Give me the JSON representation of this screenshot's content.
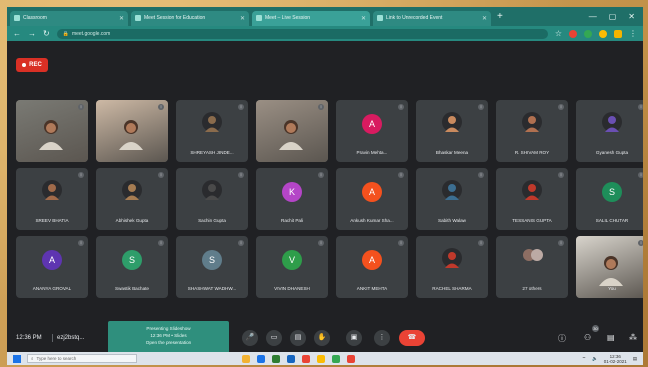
{
  "browser": {
    "tabs": [
      {
        "title": "Classroom",
        "active": false
      },
      {
        "title": "Meet Session for Education",
        "active": false
      },
      {
        "title": "Meet – Live Session",
        "active": true
      },
      {
        "title": "Link to Unrecorded Event",
        "active": false
      }
    ],
    "new_tab": "+",
    "url": "meet.google.com"
  },
  "meeting": {
    "rec_label": "REC",
    "time": "12:36 PM",
    "code": "ezj2bstq...",
    "popup_lines": [
      "Presenting Slideshow",
      "12:36 PM • Slides",
      "Open the presentation"
    ],
    "people_badge": "30"
  },
  "participants": [
    {
      "name": "",
      "type": "camera",
      "bg": "#7a7a74"
    },
    {
      "name": "",
      "type": "camera",
      "bg": "#cdb9a5"
    },
    {
      "name": "SHREYASH JINDE...",
      "type": "photo",
      "color": "#8a6b4c"
    },
    {
      "name": "",
      "type": "camera",
      "bg": "#9a8f84"
    },
    {
      "name": "Pravin Mehta...",
      "type": "avatar",
      "letter": "A",
      "color": "#d81b60"
    },
    {
      "name": "Bhaskar Meena",
      "type": "photo",
      "color": "#c98a5e"
    },
    {
      "name": "R. SHIVAM ROY",
      "type": "photo",
      "color": "#b07050"
    },
    {
      "name": "Gyanesh Gupta",
      "type": "photo",
      "color": "#6a4fb3"
    },
    {
      "name": "SREEV BHATIA",
      "type": "photo",
      "color": "#a06a4a"
    },
    {
      "name": "Abhishek Gupta",
      "type": "photo",
      "color": "#a67c52"
    },
    {
      "name": "Sachin Gupta",
      "type": "photo",
      "color": "#4a4a4a"
    },
    {
      "name": "Rachit Pali",
      "type": "avatar",
      "letter": "K",
      "color": "#b445c7"
    },
    {
      "name": "Ankush Kumar Sha...",
      "type": "avatar",
      "letter": "A",
      "color": "#f4511e"
    },
    {
      "name": "Sabith Walaw",
      "type": "photo",
      "color": "#3c6e91"
    },
    {
      "name": "TESSANIS GUPTA",
      "type": "photo",
      "color": "#c0392b"
    },
    {
      "name": "SALIL CHUTAR",
      "type": "avatar",
      "letter": "S",
      "color": "#1e8e5a"
    },
    {
      "name": "ANANYA GROVAL",
      "type": "avatar",
      "letter": "A",
      "color": "#5e35b1"
    },
    {
      "name": "Swastik Bachate",
      "type": "avatar",
      "letter": "S",
      "color": "#2e9d6a"
    },
    {
      "name": "SHASHWAT WADHW...",
      "type": "avatar",
      "letter": "S",
      "color": "#607d8b"
    },
    {
      "name": "VIVIN DHANESH",
      "type": "avatar",
      "letter": "V",
      "color": "#2e9d4a"
    },
    {
      "name": "ANKIT MEHTA",
      "type": "avatar",
      "letter": "A",
      "color": "#f4511e"
    },
    {
      "name": "RACHEL SHARMA",
      "type": "photo",
      "color": "#c0392b"
    },
    {
      "name": "27 others",
      "type": "group",
      "color": "#9aa0a6"
    },
    {
      "name": "You",
      "type": "camera",
      "bg": "#d8d4cc"
    }
  ],
  "controls": {
    "mic": "🎤",
    "cam": "▭",
    "cc": "▤",
    "hand": "✋",
    "present": "▣",
    "more": "⋮",
    "end": "☎",
    "info": "ⓘ",
    "people": "⚇",
    "chat": "▤",
    "activities": "⁂"
  },
  "taskbar": {
    "search_placeholder": "Type here to search",
    "time": "12:36",
    "date": "01-02-2021",
    "app_colors": [
      "#f2b233",
      "#1a73e8",
      "#2e7d32",
      "#1565c0",
      "#ea4335",
      "#fbbc05",
      "#34a853",
      "#ea4335"
    ]
  }
}
